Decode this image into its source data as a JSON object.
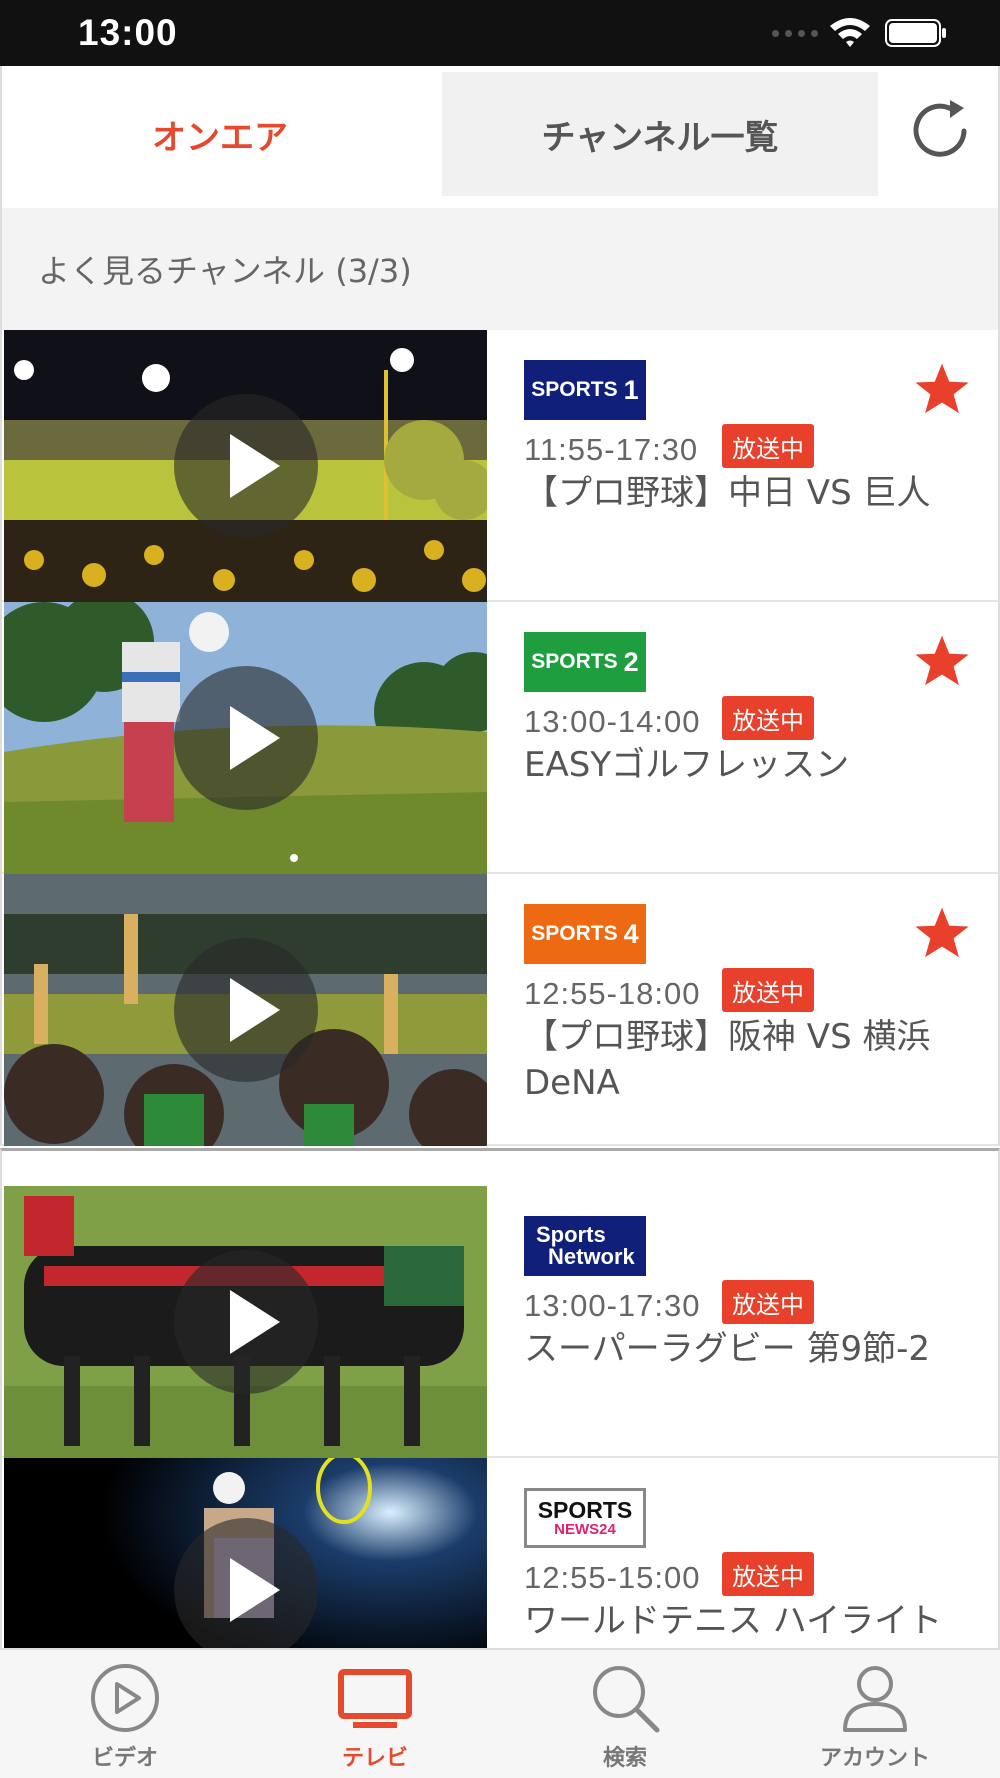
{
  "status_bar": {
    "time": "13:00"
  },
  "tabs": [
    {
      "label": "オンエア",
      "active": true
    },
    {
      "label": "チャンネル一覧",
      "active": false
    }
  ],
  "section": {
    "title": "よく見るチャンネル (3/3)"
  },
  "favorites": [
    {
      "logo_text": "SPORTS",
      "logo_num": "1",
      "logo_color": "#0f1f7a",
      "time": "11:55-17:30",
      "badge": "放送中",
      "title": "【プロ野球】中日 VS 巨人",
      "favorite": true,
      "thumbnail": "baseball-stadium"
    },
    {
      "logo_text": "SPORTS",
      "logo_num": "2",
      "logo_color": "#1e9e3e",
      "time": "13:00-14:00",
      "badge": "放送中",
      "title": "EASYゴルフレッスン",
      "favorite": true,
      "thumbnail": "golf-swing"
    },
    {
      "logo_text": "SPORTS",
      "logo_num": "4",
      "logo_color": "#ee6a12",
      "time": "12:55-18:00",
      "badge": "放送中",
      "title": "【プロ野球】阪神 VS 横浜 DeNA",
      "favorite": true,
      "thumbnail": "baseball-fans"
    }
  ],
  "others": [
    {
      "logo_line1": "Sports",
      "logo_line2": "Network",
      "logo_color": "#0f1f7a",
      "time": "13:00-17:30",
      "badge": "放送中",
      "title": "スーパーラグビー 第9節-2",
      "thumbnail": "rugby-scrum"
    },
    {
      "logo_line1": "SPORTS",
      "logo_line2": "NEWS24",
      "logo_color": "#ffffff",
      "time": "12:55-15:00",
      "badge": "放送中",
      "title": "ワールドテニス ハイライト",
      "thumbnail": "tennis-player"
    }
  ],
  "bottom_nav": [
    {
      "label": "ビデオ",
      "icon": "play-circle-icon",
      "active": false
    },
    {
      "label": "テレビ",
      "icon": "tv-icon",
      "active": true
    },
    {
      "label": "検索",
      "icon": "search-icon",
      "active": false
    },
    {
      "label": "アカウント",
      "icon": "account-icon",
      "active": false
    }
  ],
  "colors": {
    "accent": "#e54a2e",
    "live_badge": "#e8402a",
    "star": "#e8402a"
  }
}
